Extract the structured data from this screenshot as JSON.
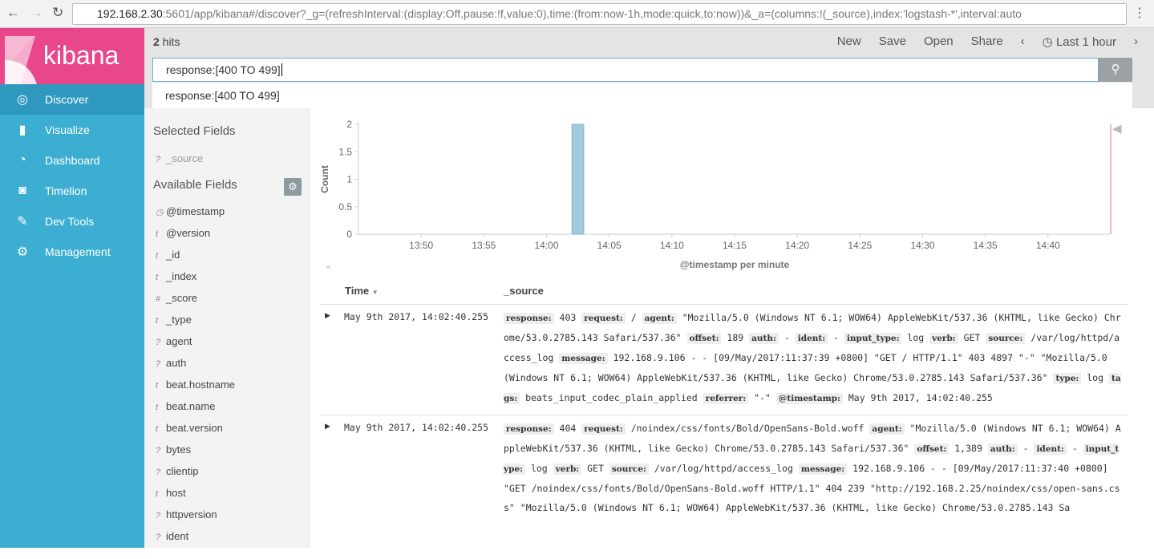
{
  "browser": {
    "url_host": "192.168.2.30",
    "url_rest": ":5601/app/kibana#/discover?_g=(refreshInterval:(display:Off,pause:!f,value:0),time:(from:now-1h,mode:quick,to:now))&_a=(columns:!(_source),index:'logstash-*',interval:auto"
  },
  "logo": "kibana",
  "sidebar": {
    "items": [
      {
        "label": "Discover",
        "icon": "compass-icon"
      },
      {
        "label": "Visualize",
        "icon": "bar-chart-icon"
      },
      {
        "label": "Dashboard",
        "icon": "dashboard-icon"
      },
      {
        "label": "Timelion",
        "icon": "timelion-icon"
      },
      {
        "label": "Dev Tools",
        "icon": "wrench-icon"
      },
      {
        "label": "Management",
        "icon": "gear-icon"
      }
    ]
  },
  "topbar": {
    "hits_count": "2",
    "hits_label": " hits",
    "menu": [
      "New",
      "Save",
      "Open",
      "Share"
    ],
    "time": "Last 1 hour"
  },
  "search": {
    "value": "response:[400 TO 499]",
    "suggestion": "response:[400 TO 499]"
  },
  "fields": {
    "selected_title": "Selected Fields",
    "selected": [
      {
        "type": "?",
        "name": "_source"
      }
    ],
    "available_title": "Available Fields",
    "available": [
      {
        "type": "◷",
        "name": "@timestamp"
      },
      {
        "type": "t",
        "name": "@version"
      },
      {
        "type": "t",
        "name": "_id"
      },
      {
        "type": "t",
        "name": "_index"
      },
      {
        "type": "#",
        "name": "_score"
      },
      {
        "type": "t",
        "name": "_type"
      },
      {
        "type": "?",
        "name": "agent"
      },
      {
        "type": "?",
        "name": "auth"
      },
      {
        "type": "t",
        "name": "beat.hostname"
      },
      {
        "type": "t",
        "name": "beat.name"
      },
      {
        "type": "t",
        "name": "beat.version"
      },
      {
        "type": "?",
        "name": "bytes"
      },
      {
        "type": "?",
        "name": "clientip"
      },
      {
        "type": "t",
        "name": "host"
      },
      {
        "type": "?",
        "name": "httpversion"
      },
      {
        "type": "?",
        "name": "ident"
      }
    ]
  },
  "chart_data": {
    "type": "bar",
    "ylabel": "Count",
    "xlabel": "@timestamp per minute",
    "ylim": [
      0,
      2
    ],
    "yticks": [
      "0",
      "0.5",
      "1",
      "1.5",
      "2"
    ],
    "xrange": [
      "13:45",
      "14:45"
    ],
    "xticks": [
      "13:50",
      "13:55",
      "14:00",
      "14:05",
      "14:10",
      "14:15",
      "14:20",
      "14:25",
      "14:30",
      "14:35",
      "14:40"
    ],
    "bars": [
      {
        "x": "14:02",
        "value": 2
      }
    ],
    "bar_color": "#a1cbdc"
  },
  "table": {
    "headers": [
      "Time",
      "_source"
    ],
    "rows": [
      {
        "time": "May 9th 2017, 14:02:40.255",
        "fields": [
          [
            "response:",
            "403"
          ],
          [
            "request:",
            "/"
          ],
          [
            "agent:",
            "\"Mozilla/5.0 (Windows NT 6.1; WOW64) AppleWebKit/537.36 (KHTML, like Gecko) Chrome/53.0.2785.143 Safari/537.36\""
          ],
          [
            "offset:",
            "189"
          ],
          [
            "auth:",
            "-"
          ],
          [
            "ident:",
            "-"
          ],
          [
            "input_type:",
            "log"
          ],
          [
            "verb:",
            "GET"
          ],
          [
            "source:",
            "/var/log/httpd/access_log"
          ],
          [
            "message:",
            "192.168.9.106 - - [09/May/2017:11:37:39 +0800] \"GET / HTTP/1.1\" 403 4897 \"-\" \"Mozilla/5.0 (Windows NT 6.1; WOW64) AppleWebKit/537.36 (KHTML, like Gecko) Chrome/53.0.2785.143 Safari/537.36\""
          ],
          [
            "type:",
            "log"
          ],
          [
            "tags:",
            "beats_input_codec_plain_applied"
          ],
          [
            "referrer:",
            "\"-\""
          ],
          [
            "@timestamp:",
            "May 9th 2017, 14:02:40.255"
          ]
        ]
      },
      {
        "time": "May 9th 2017, 14:02:40.255",
        "fields": [
          [
            "response:",
            "404"
          ],
          [
            "request:",
            "/noindex/css/fonts/Bold/OpenSans-Bold.woff"
          ],
          [
            "agent:",
            "\"Mozilla/5.0 (Windows NT 6.1; WOW64) AppleWebKit/537.36 (KHTML, like Gecko) Chrome/53.0.2785.143 Safari/537.36\""
          ],
          [
            "offset:",
            "1,389"
          ],
          [
            "auth:",
            "-"
          ],
          [
            "ident:",
            "-"
          ],
          [
            "input_type:",
            "log"
          ],
          [
            "verb:",
            "GET"
          ],
          [
            "source:",
            "/var/log/httpd/access_log"
          ],
          [
            "message:",
            "192.168.9.106 - - [09/May/2017:11:37:40 +0800] \"GET /noindex/css/fonts/Bold/OpenSans-Bold.woff HTTP/1.1\" 404 239 \"http://192.168.2.25/noindex/css/open-sans.css\" \"Mozilla/5.0 (Windows NT 6.1; WOW64) AppleWebKit/537.36 (KHTML, like Gecko) Chrome/53.0.2785.143 Sa"
          ]
        ]
      }
    ]
  }
}
